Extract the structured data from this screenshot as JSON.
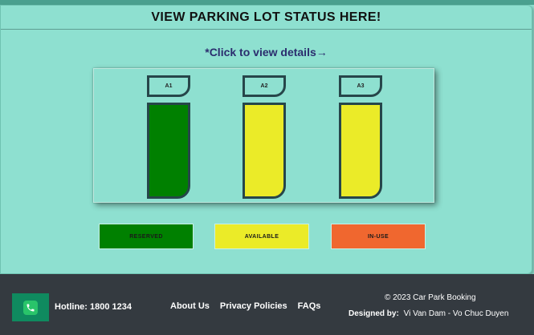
{
  "header": {
    "title": "VIEW PARKING LOT STATUS HERE!"
  },
  "hint": "*Click to view details→",
  "slots": [
    {
      "label": "A1",
      "status": "reserved",
      "color": "#008000"
    },
    {
      "label": "A2",
      "status": "available",
      "color": "#ebeb28"
    },
    {
      "label": "A3",
      "status": "available",
      "color": "#ebeb28"
    }
  ],
  "legend": [
    {
      "label": "RESERVED",
      "color": "#008000"
    },
    {
      "label": "AVAILABLE",
      "color": "#ebeb28"
    },
    {
      "label": "IN-USE",
      "color": "#f0672f"
    }
  ],
  "footer": {
    "phone_icon": "phone-icon",
    "hotline": "Hotline: 1800 1234",
    "links": [
      "About Us",
      "Privacy Policies",
      "FAQs"
    ],
    "copyright": "© 2023 Car Park Booking",
    "designed_by_label": "Designed by:",
    "designers": "Vi Van Dam - Vo Chuc Duyen"
  },
  "colors": {
    "background": "#8ee0d0",
    "footer_bg": "#343a40",
    "slot_border": "#26464a",
    "hint_text": "#2b2d6e"
  }
}
